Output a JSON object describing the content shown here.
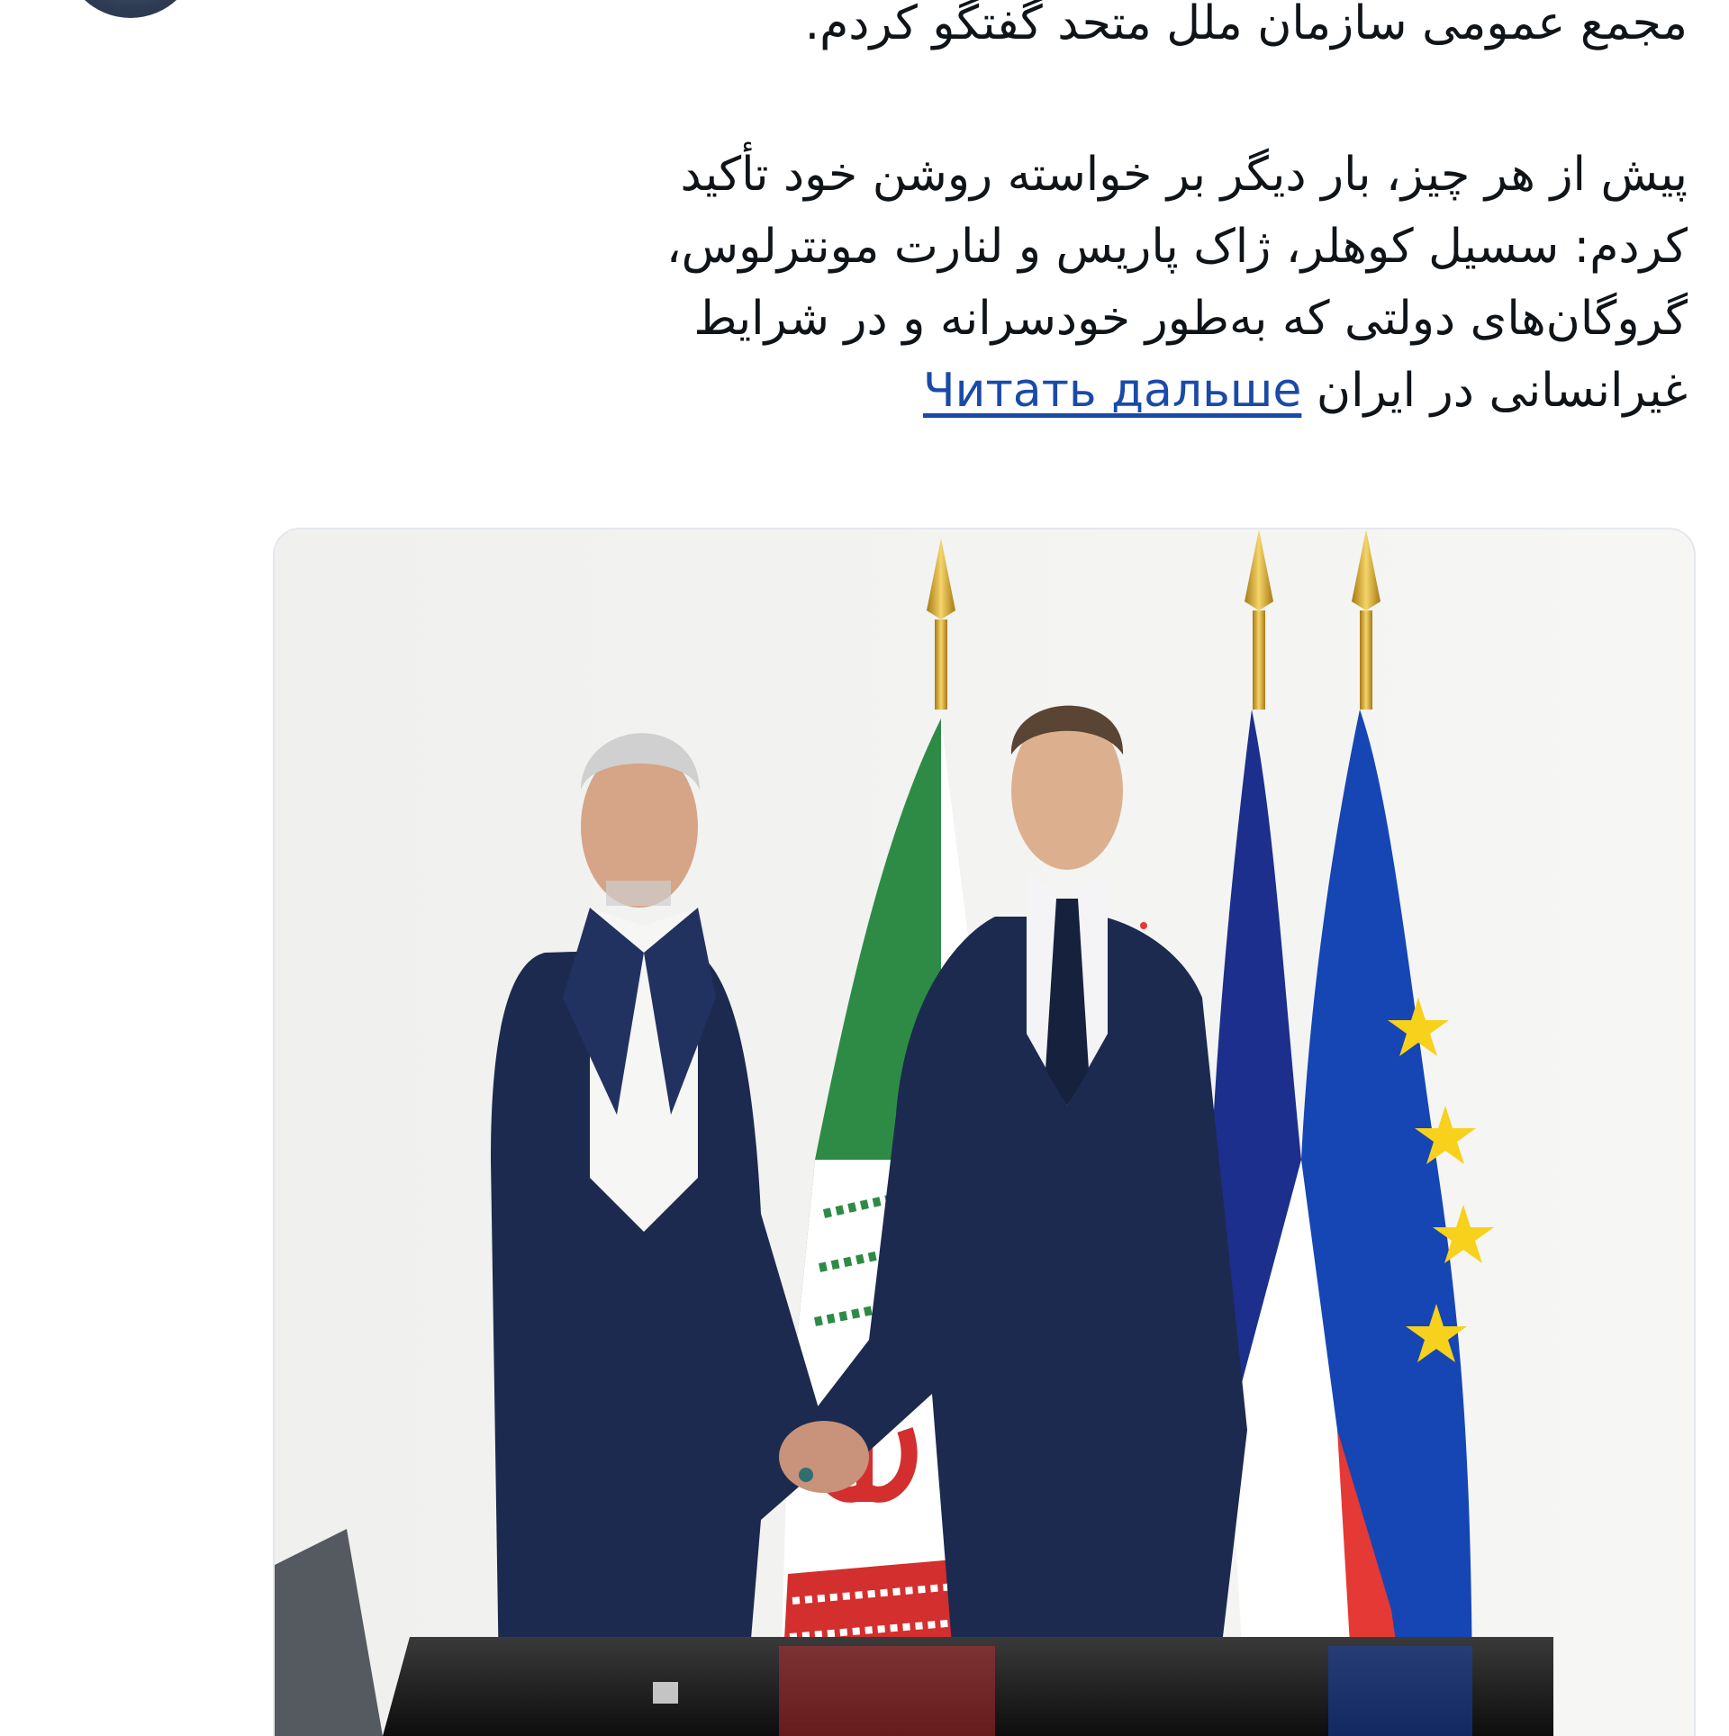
{
  "post": {
    "paragraphs": [
      "مجمع عمومی سازمان ملل متحد گفتگو کردم.",
      "پیش از هر چیز، بار دیگر بر خواسته روشن خود تأکید",
      "کردم: سسیل کوهلر، ژاک پاریس و لنارت مونترلوس،",
      "گروگان‌های دولتی که به‌طور خودسرانه و در شرایط"
    ],
    "last_line_text": "غیرانسانی در ایران",
    "read_more": "Читать дальше"
  },
  "photo": {
    "flags": [
      "iran-flag",
      "france-flag",
      "eu-flag"
    ],
    "colors": {
      "iran_green": "#2e8b46",
      "iran_red": "#d32f2f",
      "france_blue": "#1c2f8c",
      "eu_blue": "#1646b4",
      "eu_star": "#f7d11b",
      "suit": "#1c2a4f"
    }
  }
}
